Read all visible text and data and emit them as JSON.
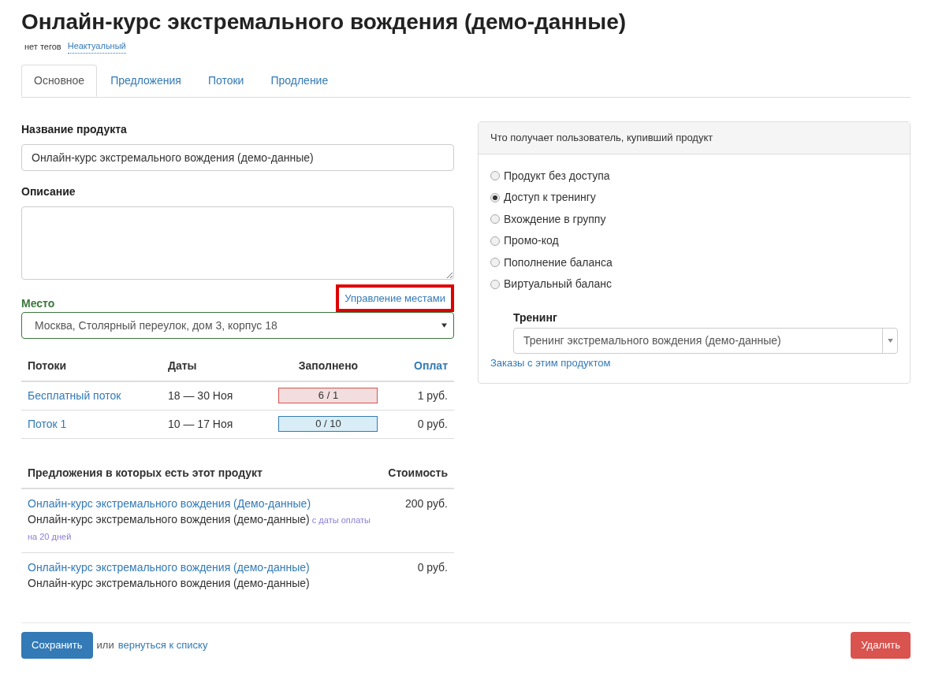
{
  "page_title": "Онлайн-курс экстремального вождения (демо-данные)",
  "tags_label": "нет тегов",
  "status_link": "Неактуальный",
  "tabs": [
    {
      "label": "Основное",
      "selected": true
    },
    {
      "label": "Предложения",
      "selected": false
    },
    {
      "label": "Потоки",
      "selected": false
    },
    {
      "label": "Продление",
      "selected": false
    }
  ],
  "product_name": {
    "label": "Название продукта",
    "value": "Онлайн-курс экстремального вождения (демо-данные)"
  },
  "description": {
    "label": "Описание"
  },
  "place": {
    "label": "Место",
    "manage_link": "Управление местами",
    "highlighted": true,
    "value": "Москва, Столярный переулок, дом 3, корпус 18"
  },
  "streams_table": {
    "columns": [
      "Потоки",
      "Даты",
      "Заполнено",
      "Оплат"
    ],
    "rows": [
      {
        "name": "Бесплатный поток",
        "dates": "18 — 30 Ноя",
        "filled": "6 / 1",
        "over_capacity": true,
        "payments": "1 руб."
      },
      {
        "name": "Поток 1",
        "dates": "10 — 17 Ноя",
        "filled": "0 / 10",
        "over_capacity": false,
        "payments": "0 руб."
      }
    ]
  },
  "offers_table": {
    "columns": [
      "Предложения в которых есть этот продукт",
      "Стоимость"
    ],
    "rows": [
      {
        "title": "Онлайн-курс экстремального вождения (Демо-данные)",
        "description": "Онлайн-курс экстремального вождения (демо-данные)",
        "note": "с даты оплаты на 20 дней",
        "price": "200 руб."
      },
      {
        "title": "Онлайн-курс экстремального вождения (демо-данные)",
        "description": "Онлайн-курс экстремального вождения (демо-данные)",
        "price": "0 руб."
      }
    ]
  },
  "access_panel": {
    "title": "Что получает пользователь, купивший продукт",
    "options": [
      {
        "label": "Продукт без доступа",
        "selected": false
      },
      {
        "label": "Доступ к тренингу",
        "selected": true
      },
      {
        "label": "Вхождение в группу",
        "selected": false
      },
      {
        "label": "Промо-код",
        "selected": false
      },
      {
        "label": "Пополнение баланса",
        "selected": false
      },
      {
        "label": "Виртуальный баланс",
        "selected": false
      }
    ],
    "training_label": "Тренинг",
    "training_value": "Тренинг экстремального вождения (демо-данные)",
    "orders_link": "Заказы с этим продуктом"
  },
  "footer": {
    "save_button": "Сохранить",
    "or_text": "или",
    "back_link": "вернуться к списку",
    "delete_button": "Удалить"
  }
}
